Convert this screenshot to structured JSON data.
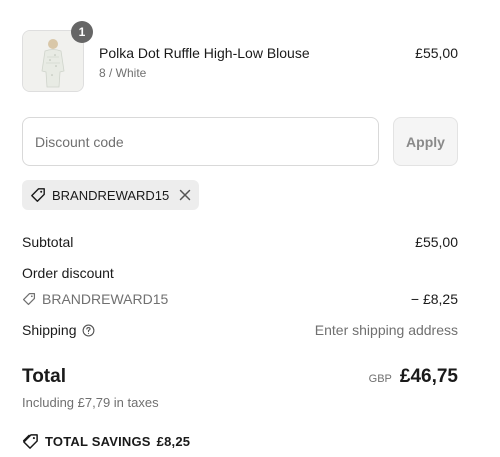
{
  "line_item": {
    "quantity": "1",
    "name": "Polka Dot Ruffle High-Low Blouse",
    "variant": "8 / White",
    "price": "£55,00",
    "image_icon": "product-photo"
  },
  "discount": {
    "placeholder": "Discount code",
    "value": "",
    "apply_label": "Apply"
  },
  "applied_code": {
    "code": "BRANDREWARD15",
    "icon": "tag-icon",
    "remove_icon": "close-icon"
  },
  "summary": {
    "subtotal_label": "Subtotal",
    "subtotal_value": "£55,00",
    "order_discount_label": "Order discount",
    "discount_code": "BRANDREWARD15",
    "discount_value": "− £8,25",
    "shipping_label": "Shipping",
    "shipping_value": "Enter shipping address",
    "total_label": "Total",
    "currency": "GBP",
    "total_value": "£46,75",
    "taxes_note": "Including £7,79 in taxes",
    "savings_label": "TOTAL SAVINGS",
    "savings_value": "£8,25"
  },
  "colors": {
    "badge": "#666666",
    "muted_text": "#707070",
    "tag_bg": "#ededed",
    "apply_bg": "#f5f5f5"
  }
}
